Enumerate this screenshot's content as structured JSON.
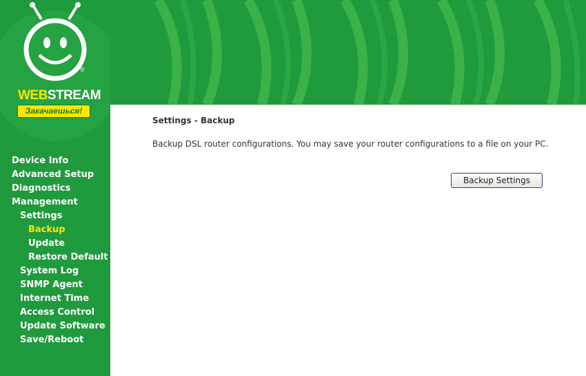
{
  "brand": {
    "name_part1": "WEB",
    "name_part2": "STREAM",
    "slogan": "Закачаешься!",
    "reg_mark": "®",
    "logo_icon": "smiley-tv-icon"
  },
  "colors": {
    "primary_green": "#1f9a3c",
    "accent_yellow": "#ffe600",
    "text": "#333333"
  },
  "sidebar": {
    "items": [
      {
        "label": "Device Info",
        "level": 0
      },
      {
        "label": "Advanced Setup",
        "level": 0
      },
      {
        "label": "Diagnostics",
        "level": 0
      },
      {
        "label": "Management",
        "level": 0
      },
      {
        "label": "Settings",
        "level": 1
      },
      {
        "label": "Backup",
        "level": 2,
        "active": true
      },
      {
        "label": "Update",
        "level": 2
      },
      {
        "label": "Restore Default",
        "level": 2
      },
      {
        "label": "System Log",
        "level": 1
      },
      {
        "label": "SNMP Agent",
        "level": 1
      },
      {
        "label": "Internet Time",
        "level": 1
      },
      {
        "label": "Access Control",
        "level": 1
      },
      {
        "label": "Update Software",
        "level": 1
      },
      {
        "label": "Save/Reboot",
        "level": 1
      }
    ]
  },
  "main": {
    "title": "Settings - Backup",
    "description": "Backup DSL router configurations. You may save your router configurations to a file on your PC.",
    "backup_button": "Backup Settings"
  }
}
